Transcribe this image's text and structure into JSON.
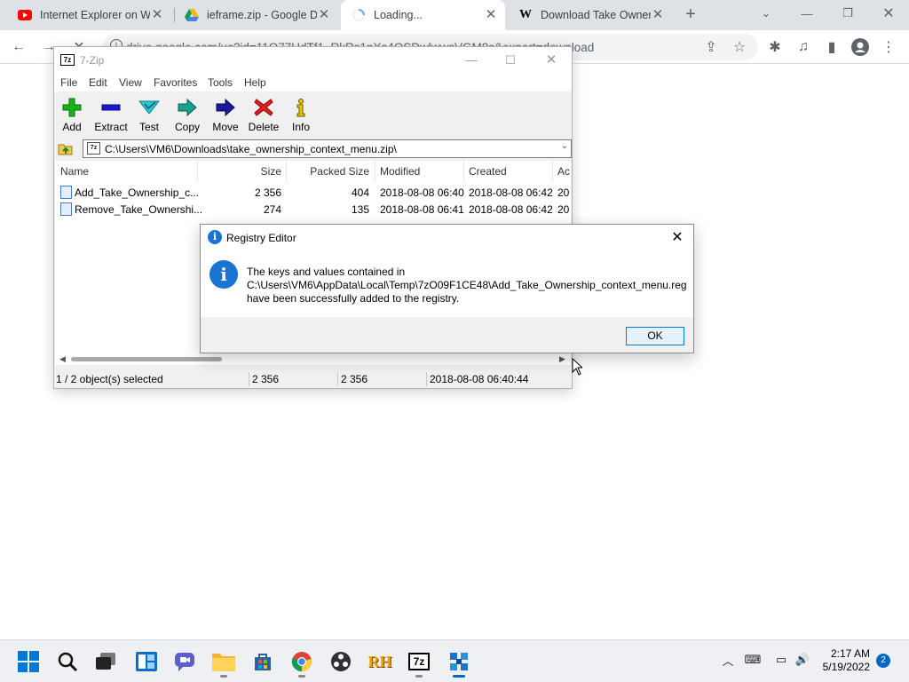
{
  "browser": {
    "tabs": [
      {
        "title": "Internet Explorer on W",
        "icon": "youtube-icon"
      },
      {
        "title": "ieframe.zip - Google Dr",
        "icon": "google-drive-icon"
      },
      {
        "title": "Loading...",
        "icon": "loading-spinner-icon"
      },
      {
        "title": "Download Take Owner",
        "icon": "wiki-w-icon"
      }
    ],
    "url": "drive.google.com/uc?id=11O77UdTf1_RkRs1nXs4OSDwlwwsVGM8s&export=download"
  },
  "zip_window": {
    "title": "7-Zip",
    "app_icon_text": "7z",
    "menu": [
      "File",
      "Edit",
      "View",
      "Favorites",
      "Tools",
      "Help"
    ],
    "toolbar": [
      "Add",
      "Extract",
      "Test",
      "Copy",
      "Move",
      "Delete",
      "Info"
    ],
    "address": "C:\\Users\\VM6\\Downloads\\take_ownership_context_menu.zip\\",
    "columns": [
      "Name",
      "Size",
      "Packed Size",
      "Modified",
      "Created",
      "Ac"
    ],
    "files": [
      {
        "name": "Add_Take_Ownership_c...",
        "size": "2 356",
        "packed": "404",
        "modified": "2018-08-08 06:40",
        "created": "2018-08-08 06:42",
        "accessed": "20"
      },
      {
        "name": "Remove_Take_Ownershi...",
        "size": "274",
        "packed": "135",
        "modified": "2018-08-08 06:41",
        "created": "2018-08-08 06:42",
        "accessed": "20"
      }
    ],
    "status": {
      "selected": "1 / 2 object(s) selected",
      "size": "2 356",
      "packed": "2 356",
      "modified": "2018-08-08 06:40:44"
    }
  },
  "dialog": {
    "title": "Registry Editor",
    "line1": "The keys and values contained in",
    "line2": "C:\\Users\\VM6\\AppData\\Local\\Temp\\7zO09F1CE48\\Add_Take_Ownership_context_menu.reg",
    "line3": "have been successfully added to the registry.",
    "ok": "OK"
  },
  "taskbar": {
    "time": "2:17 AM",
    "date": "5/19/2022",
    "notifications": "2",
    "apps": [
      "start-icon",
      "search-icon",
      "task-view-icon",
      "widgets-icon",
      "teams-chat-icon",
      "file-explorer-icon",
      "store-icon",
      "chrome-icon",
      "obs-icon",
      "rh-icon",
      "7zip-taskbar-icon",
      "registry-editor-icon"
    ]
  }
}
